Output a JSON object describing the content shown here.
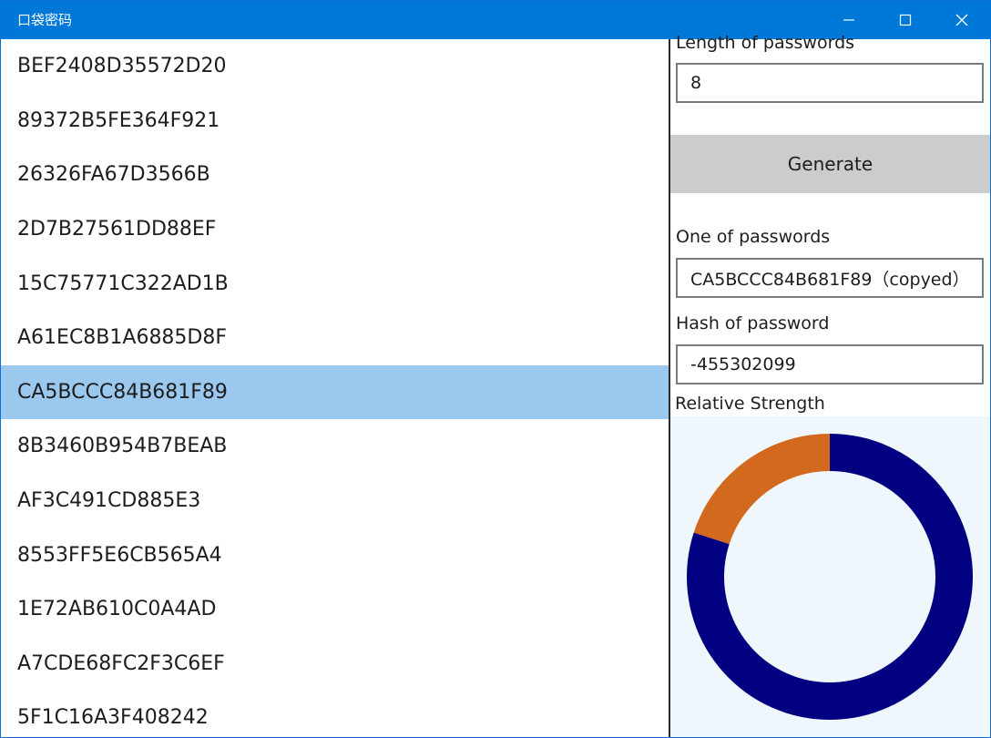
{
  "window": {
    "title": "口袋密码"
  },
  "passwords": [
    "BEF2408D35572D20",
    "89372B5FE364F921",
    "26326FA67D3566B",
    "2D7B27561DD88EF",
    "15C75771C322AD1B",
    "A61EC8B1A6885D8F",
    "CA5BCCC84B681F89",
    "8B3460B954B7BEAB",
    "AF3C491CD885E3",
    "8553FF5E6CB565A4",
    "1E72AB610C0A4AD",
    "A7CDE68FC2F3C6EF",
    "5F1C16A3F408242"
  ],
  "selected_index": 6,
  "panel": {
    "length_label": "Length of passwords",
    "length_value": "8",
    "generate_label": "Generate",
    "one_label": "One of passwords",
    "one_value": "CA5BCCC84B681F89（copyed）",
    "hash_label": "Hash of password",
    "hash_value": "-455302099",
    "strength_label": "Relative Strength"
  },
  "colors": {
    "titlebar": "#0078d7",
    "selection": "#9bc8ee",
    "strength_main": "#000080",
    "strength_rest": "#d2691e",
    "chart_bg": "#eff6fc"
  },
  "chart_data": {
    "type": "pie",
    "donut": true,
    "slices": [
      {
        "value": 0.8
      },
      {
        "value": 0.2
      }
    ]
  }
}
